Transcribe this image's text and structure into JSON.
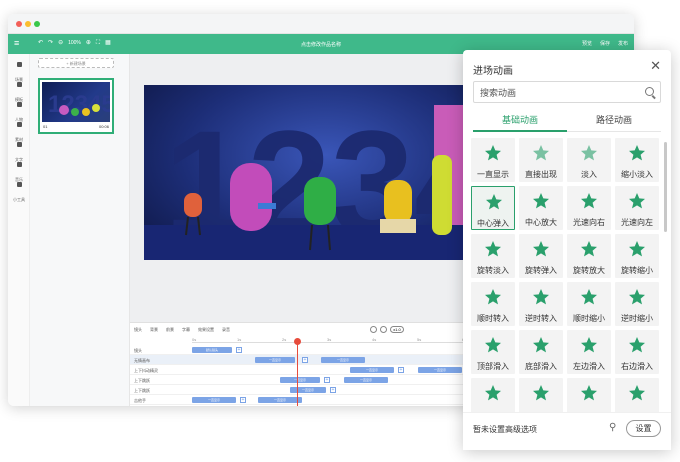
{
  "app": {
    "project_title": "点击修改作品名称",
    "toolbar": {
      "zoom": "100%",
      "menu_icon": "menu-icon",
      "undo_icon": "undo-icon",
      "redo_icon": "redo-icon",
      "right_items": [
        "预览",
        "保存",
        "发布"
      ]
    },
    "left_nav": [
      "场景",
      "模板",
      "人物",
      "素材",
      "文字",
      "音乐",
      "小工具"
    ],
    "scenes": {
      "add_label": "+ 新建场景",
      "items": [
        {
          "index": "01",
          "duration": "00:06"
        }
      ]
    },
    "timeline": {
      "tools": [
        "镜头",
        "背景",
        "前景",
        "字幕",
        "效果设置",
        "录音"
      ],
      "ruler": [
        "0s",
        "1s",
        "2s",
        "3s",
        "4s",
        "5s",
        "6s"
      ],
      "speed": "x1.0",
      "rows": [
        {
          "name": "镜头",
          "clips": [
            {
              "label": "默认镜头"
            }
          ]
        },
        {
          "name": "无情画布",
          "clips": [
            {
              "label": "一直显示"
            },
            {
              "label": "一直显示"
            }
          ]
        },
        {
          "name": "上下抖动精灵",
          "clips": [
            {
              "label": "一直显示"
            },
            {
              "label": "一直显示"
            }
          ]
        },
        {
          "name": "上下跳跃",
          "clips": [
            {
              "label": "一直显示"
            },
            {
              "label": "一直显示"
            }
          ]
        },
        {
          "name": "上下跳跃",
          "clips": [
            {
              "label": "一直显示"
            }
          ]
        },
        {
          "name": "吉他手",
          "clips": [
            {
              "label": "一直显示"
            },
            {
              "label": "一直显示"
            }
          ]
        }
      ]
    }
  },
  "panel": {
    "title": "进场动画",
    "close_icon": "close-icon",
    "search_placeholder": "搜索动画",
    "tabs": [
      {
        "label": "基础动画",
        "active": true
      },
      {
        "label": "路径动画",
        "active": false
      }
    ],
    "accent": "#2aa06c",
    "animations": [
      "一直显示",
      "直接出现",
      "淡入",
      "缩小淡入",
      "中心弹入",
      "中心放大",
      "光速向右",
      "光速向左",
      "旋转淡入",
      "旋转弹入",
      "旋转放大",
      "旋转缩小",
      "顺时转入",
      "逆时转入",
      "顺时缩小",
      "逆时缩小",
      "顶部滑入",
      "底部滑入",
      "左边滑入",
      "右边滑入",
      "",
      "",
      "",
      ""
    ],
    "selected_index": 4,
    "footer_text": "暂未设置高级选项",
    "footer_button": "设置"
  }
}
